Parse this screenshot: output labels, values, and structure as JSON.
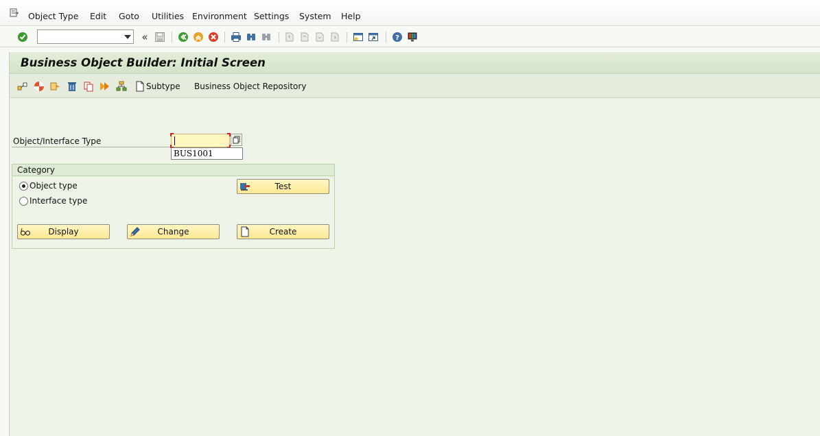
{
  "menubar": {
    "items": [
      {
        "label": "Object Type"
      },
      {
        "label": "Edit"
      },
      {
        "label": "Goto"
      },
      {
        "label": "Utilities"
      },
      {
        "label": "Environment"
      },
      {
        "label": "Settings"
      },
      {
        "label": "System"
      },
      {
        "label": "Help"
      }
    ]
  },
  "toolbar": {
    "command_field_value": "",
    "icons": [
      "enter-icon",
      "collapse-icon",
      "save-icon",
      "back-icon",
      "exit-icon",
      "cancel-icon",
      "print-icon",
      "find-icon",
      "find-next-icon",
      "first-page-icon",
      "previous-page-icon",
      "next-page-icon",
      "last-page-icon",
      "new-session-icon",
      "shortcut-icon",
      "help-icon",
      "customize-layout-icon"
    ]
  },
  "screen": {
    "title": "Business Object Builder: Initial Screen"
  },
  "app_toolbar": {
    "icons": [
      "other-object-icon",
      "check-icon",
      "generate-icon",
      "delete-icon",
      "copy-icon",
      "activate-icon",
      "hierarchy-icon",
      "subtype-page-icon"
    ],
    "subtype_label": "Subtype",
    "repository_label": "Business Object Repository"
  },
  "object_field": {
    "label": "Object/Interface Type",
    "value": "",
    "history_entry": "BUS1001"
  },
  "category": {
    "header": "Category",
    "options": [
      {
        "label": "Object type",
        "selected": true
      },
      {
        "label": "Interface type",
        "selected": false
      }
    ]
  },
  "buttons": {
    "test": "Test",
    "display": "Display",
    "change": "Change",
    "create": "Create"
  },
  "colors": {
    "button_fill": "#fbe792",
    "input_fill": "#fff6c0",
    "title_bar": "#d3e2c6",
    "background": "#eef3e8"
  }
}
